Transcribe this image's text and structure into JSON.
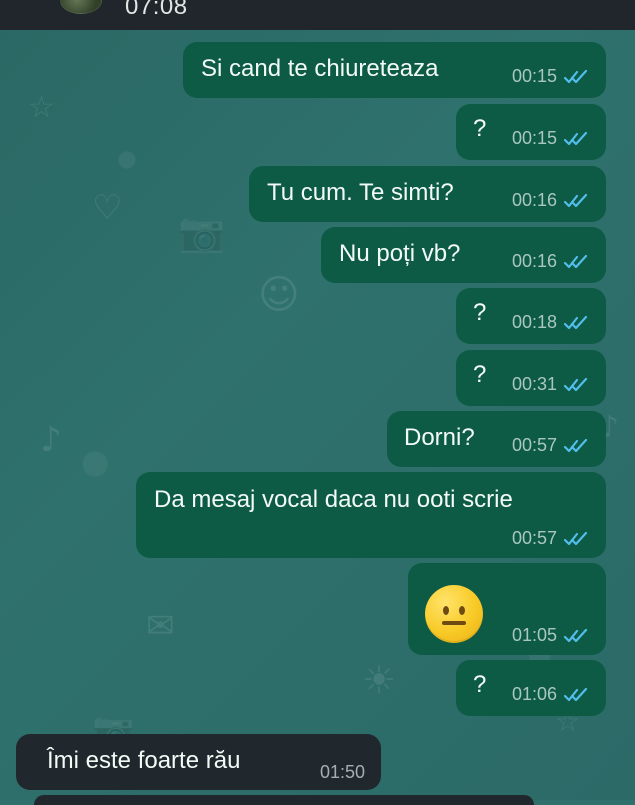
{
  "header": {
    "time": "07:08"
  },
  "messages": [
    {
      "text": "Si cand te chiureteaza",
      "time": "00:15",
      "direction": "out",
      "status_icon": "double-check-icon"
    },
    {
      "text": "?",
      "time": "00:15",
      "direction": "out",
      "status_icon": "double-check-icon"
    },
    {
      "text": "Tu cum. Te simti?",
      "time": "00:16",
      "direction": "out",
      "status_icon": "double-check-icon"
    },
    {
      "text": "Nu poți vb?",
      "time": "00:16",
      "direction": "out",
      "status_icon": "double-check-icon"
    },
    {
      "text": "?",
      "time": "00:18",
      "direction": "out",
      "status_icon": "double-check-icon"
    },
    {
      "text": "?",
      "time": "00:31",
      "direction": "out",
      "status_icon": "double-check-icon"
    },
    {
      "text": "Dorni?",
      "time": "00:57",
      "direction": "out",
      "status_icon": "double-check-icon"
    },
    {
      "text": "Da mesaj vocal daca nu ooti scrie",
      "time": "00:57",
      "direction": "out",
      "status_icon": "double-check-icon"
    },
    {
      "emoji": "neutral-face-icon",
      "time": "01:05",
      "direction": "out",
      "status_icon": "double-check-icon"
    },
    {
      "text": "?",
      "time": "01:06",
      "direction": "out",
      "status_icon": "double-check-icon"
    },
    {
      "text": "Îmi este foarte rău",
      "time": "01:50",
      "direction": "in"
    }
  ],
  "theme": {
    "chat_background": "#2f6f6c",
    "outgoing_bubble": "#0d5b45",
    "incoming_bubble": "#20272d",
    "tick_color": "#53bdeb"
  }
}
